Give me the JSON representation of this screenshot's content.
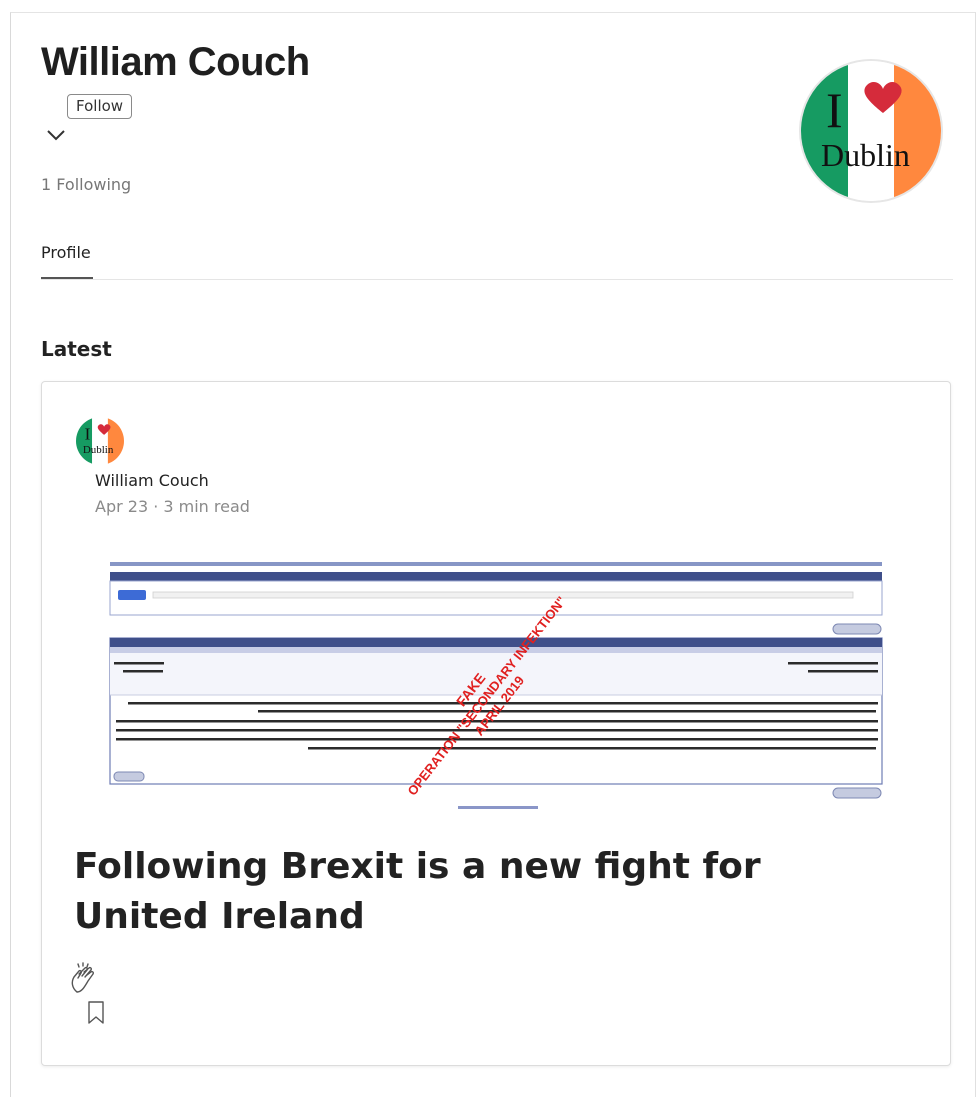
{
  "profile": {
    "name": "William Couch",
    "follow_label": "Follow",
    "following_count": "1 Following",
    "avatar": {
      "word_top": "I",
      "word_bottom": "Dublin",
      "flag_colors": [
        "#169b62",
        "#ffffff",
        "#ff883e"
      ],
      "heart_color": "#d52b3b"
    }
  },
  "tabs": [
    {
      "label": "Profile",
      "active": true
    }
  ],
  "section_title": "Latest",
  "post": {
    "author": "William Couch",
    "meta": "Apr 23 · 3 min read",
    "image_stamp": {
      "line1": "FAKE",
      "line2": "OPERATION \"SECONDARY INFEKTION\"",
      "line3": "APRIL 2019",
      "color": "#e02020"
    },
    "title": "Following Brexit is a new fight for United Ireland"
  },
  "icons": {
    "clap": "clap-icon",
    "bookmark": "bookmark-icon",
    "chevron": "chevron-down-icon"
  }
}
